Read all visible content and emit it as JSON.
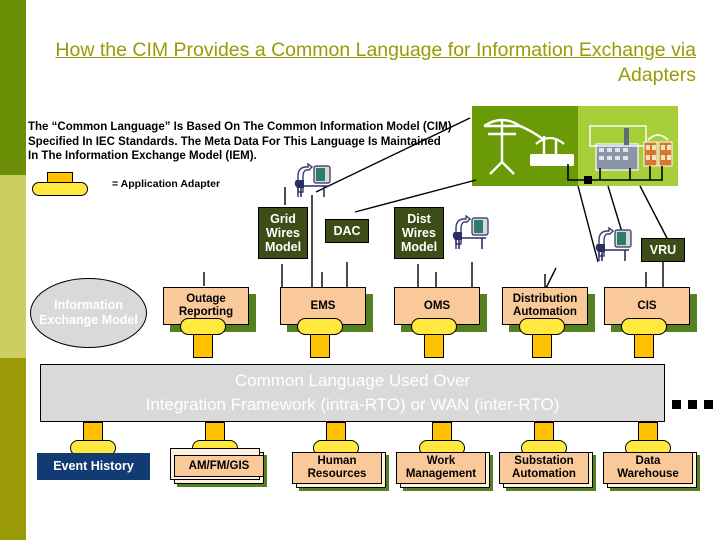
{
  "slide": {
    "title_line1": "How the CIM Provides a Common Language for Information Exchange via",
    "title_line2": "Adapters",
    "body_line1": "The “Common Language” Is Based On The Common Information Model (CIM)",
    "body_line2": "Specified In IEC Standards.  The Meta Data For This Language Is Maintained",
    "body_line3": "In The Information Exchange Model (IEM).",
    "legend_label": "= Application Adapter",
    "iem_label": "Information Exchange Model",
    "common_language_line1": "Common Language Used Over",
    "common_language_line2": "Integration Framework (intra-RTO) or WAN (inter-RTO)"
  },
  "colors": {
    "title": "#9a9a06",
    "strip_top": "#6b8f07",
    "strip_mid": "#ccce61",
    "strip_bottom": "#9a9a06",
    "model_box": "#3d4d17",
    "app_face": "#fac99a",
    "app_shadow": "#558022",
    "adapter_cap": "#ffe93f",
    "adapter_stem": "#ffc000",
    "bar": "#d9d9d9",
    "navy": "#133b73",
    "photo_left": "#6a9a05",
    "photo_right": "#a6ce39"
  },
  "model_boxes": [
    {
      "label": "Grid Wires Model"
    },
    {
      "label": "DAC"
    },
    {
      "label": "Dist Wires Model"
    },
    {
      "label": "VRU"
    }
  ],
  "applications": [
    {
      "label": "Outage Reporting"
    },
    {
      "label": "EMS"
    },
    {
      "label": "OMS"
    },
    {
      "label": "Distribution Automation"
    },
    {
      "label": "CIS"
    }
  ],
  "bottom_applications": [
    {
      "label": "Event History"
    },
    {
      "label": "AM/FM/GIS"
    },
    {
      "label": "Human Resources"
    },
    {
      "label": "Work Management"
    },
    {
      "label": "Substation Automation"
    },
    {
      "label": "Data Warehouse"
    }
  ]
}
